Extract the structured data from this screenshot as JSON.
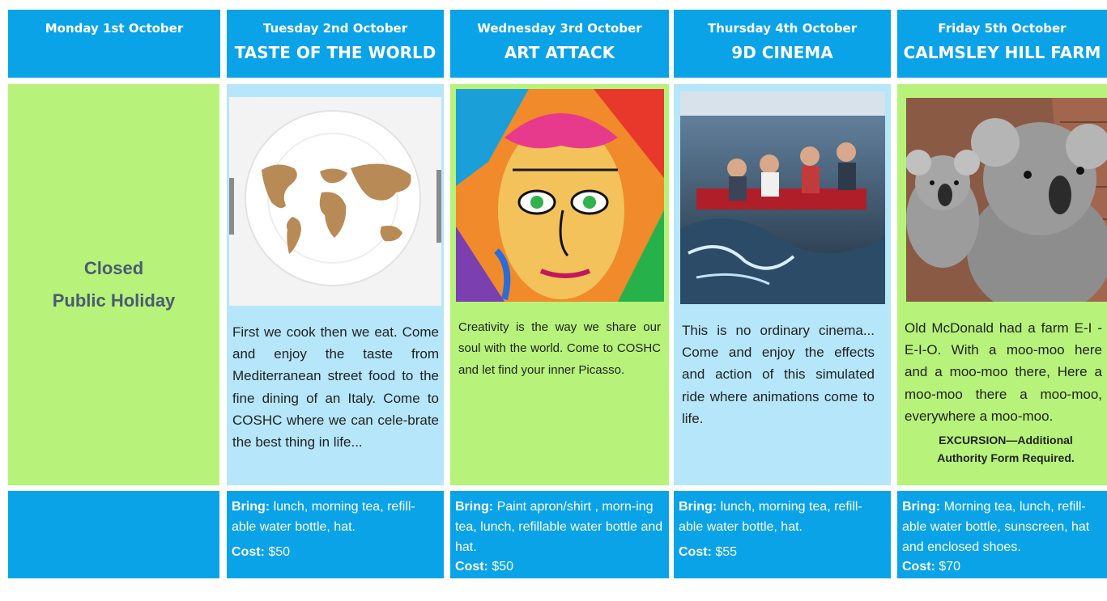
{
  "days": [
    {
      "day": "Monday 1st October",
      "title": ""
    },
    {
      "day": "Tuesday 2nd October",
      "title": "TASTE OF THE WORLD"
    },
    {
      "day": "Wednesday 3rd October",
      "title": "ART ATTACK"
    },
    {
      "day": "Thursday 4th October",
      "title": "9D CINEMA"
    },
    {
      "day": "Friday 5th October",
      "title": "CALMSLEY HILL FARM"
    }
  ],
  "closed": {
    "line1": "Closed",
    "line2": "Public Holiday"
  },
  "descriptions": {
    "tuesday": "First we cook then we eat. Come and enjoy the taste from Mediterranean street food to the fine dining of an Italy. Come to COSHC where we can cele-brate the best thing in life...",
    "wednesday": "Creativity is the way we share our soul with the world. Come to COSHC and let find your inner Picasso.",
    "thursday": "This is no ordinary cinema... Come and enjoy the effects and action of this simulated ride where animations come to life.",
    "friday": "Old McDonald had a farm E-I -E-I-O. With a moo-moo here and a moo-moo there, Here a moo-moo there a moo-moo, everywhere a moo-moo.",
    "friday_note": "EXCURSION—Additional Authority Form Required."
  },
  "bring_label": "Bring:",
  "cost_label": "Cost:",
  "bring": {
    "tuesday": "lunch, morning tea, refill-able water bottle, hat.",
    "wednesday": "Paint apron/shirt , morn-ing tea, lunch, refillable water bottle and hat.",
    "thursday": "lunch, morning tea, refill-able water bottle, hat.",
    "friday": "Morning tea, lunch, refill-able water bottle, sunscreen, hat and enclosed shoes."
  },
  "cost": {
    "tuesday": "$50",
    "wednesday": "$50",
    "thursday": "$55",
    "friday": "$70"
  }
}
